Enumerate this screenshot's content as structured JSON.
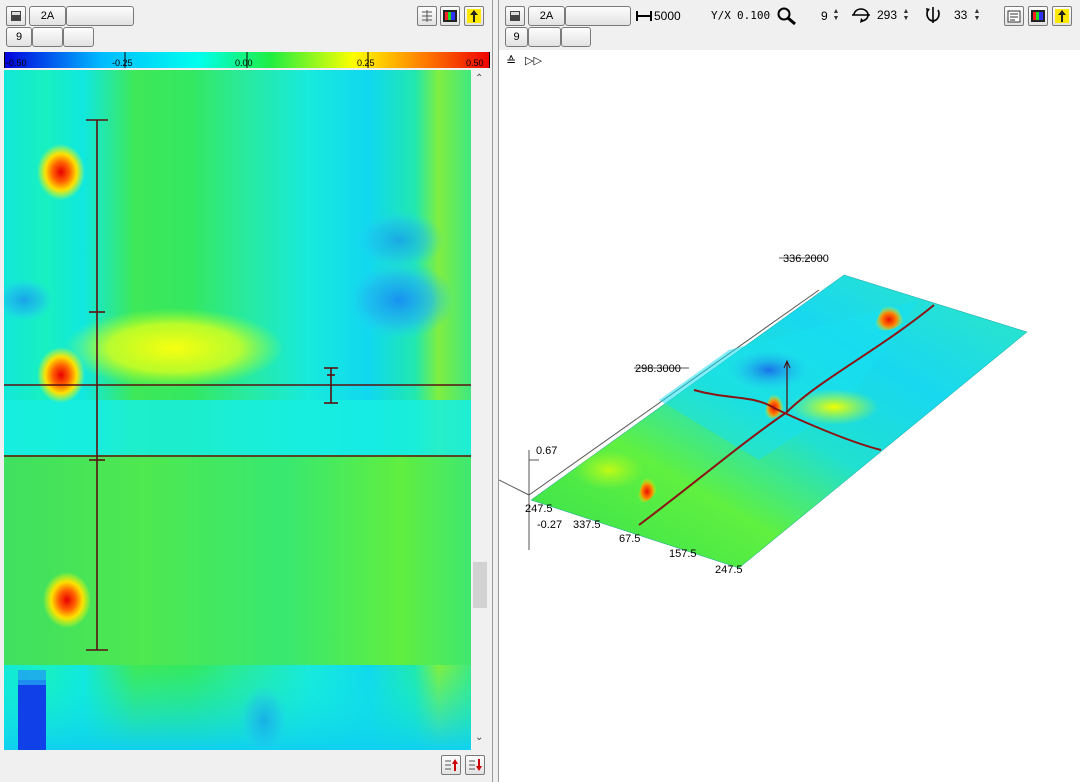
{
  "left": {
    "toolbar": {
      "channel_label": "2A",
      "field_label": "",
      "row2_label": "9",
      "row2_field1": "",
      "row2_field2": ""
    },
    "colorbar": {
      "tick_labels": [
        "-0.50",
        "-0.25",
        "0.00",
        "0.25",
        "0.50"
      ],
      "colors": [
        "#0000dd",
        "#00bbff",
        "#00ffee",
        "#20ee40",
        "#ffff00",
        "#ff8000",
        "#ee0000"
      ]
    }
  },
  "right": {
    "toolbar": {
      "channel_label": "2A",
      "field_label": "",
      "row2_label": "9",
      "row2_field1": "",
      "row2_field2": "",
      "length_value": "5000",
      "yx_label": "Y/X",
      "yx_value": "0.100",
      "rot_x_value": "9",
      "rot_z_value": "293",
      "tilt_value": "33"
    },
    "plot3d": {
      "z_max_label": "0.67",
      "z_min_label": "-0.27",
      "back_axis_labels": [
        "336.2000",
        "298.3000"
      ],
      "front_axis_labels": [
        "247.5",
        "337.5",
        "67.5",
        "157.5",
        "247.5"
      ]
    }
  }
}
